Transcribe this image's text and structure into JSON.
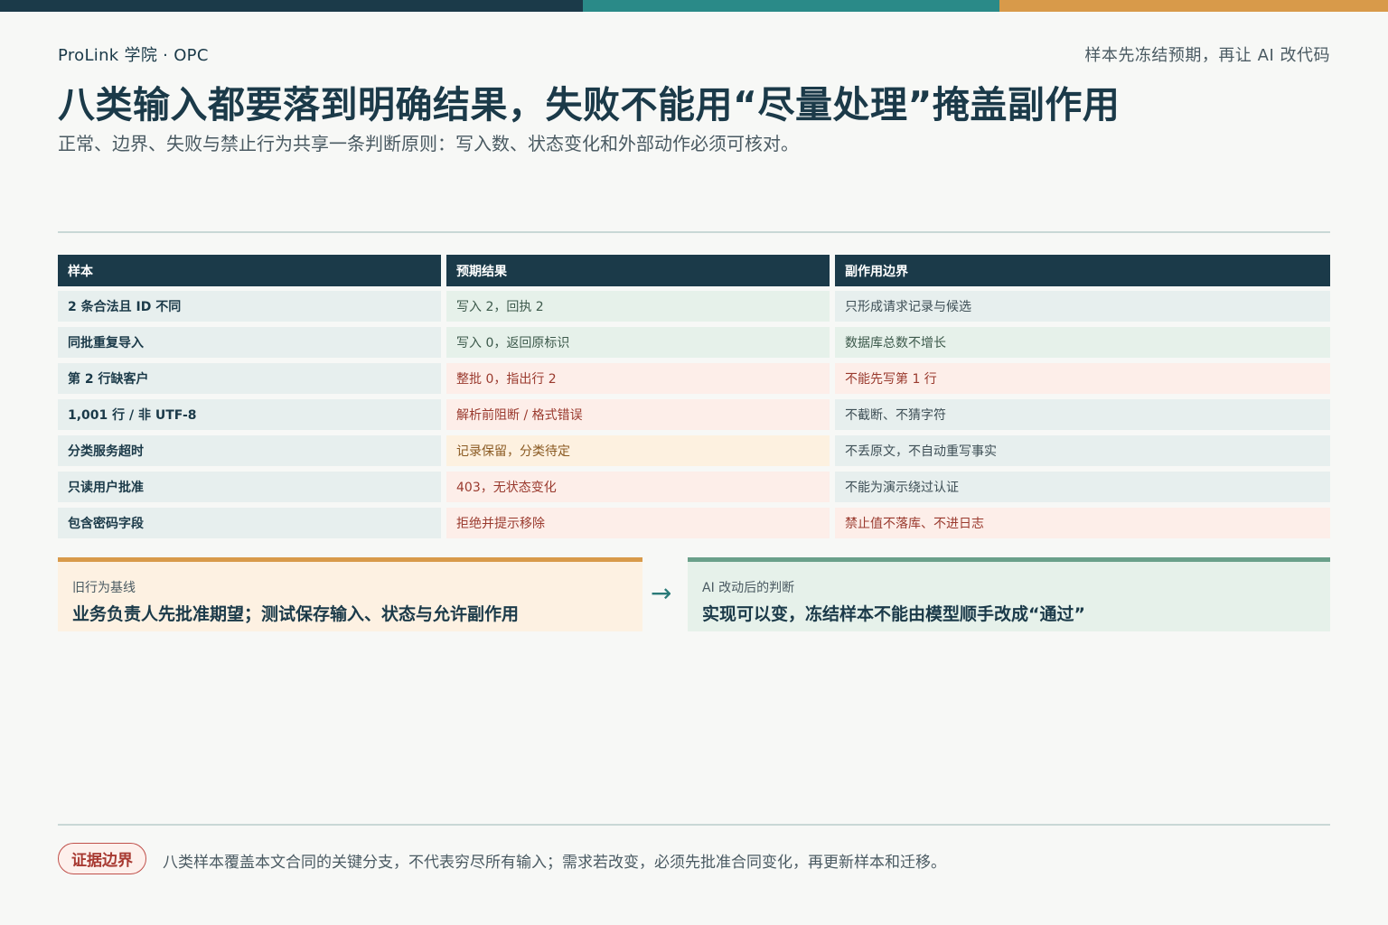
{
  "header": {
    "brand": "ProLink 学院 · OPC",
    "tagline": "样本先冻结预期，再让 AI 改代码",
    "title": "八类输入都要落到明确结果，失败不能用“尽量处理”掩盖副作用",
    "subtitle": "正常、边界、失败与禁止行为共享一条判断原则：写入数、状态变化和外部动作必须可核对。"
  },
  "table": {
    "columns": [
      "样本",
      "预期结果",
      "副作用边界"
    ],
    "rows": [
      {
        "sample": "2 条合法且 ID 不同",
        "expected": "写入 2，回执 2",
        "boundary": "只形成请求记录与候选",
        "expected_tone": "green",
        "boundary_tone": "neutral"
      },
      {
        "sample": "同批重复导入",
        "expected": "写入 0，返回原标识",
        "boundary": "数据库总数不增长",
        "expected_tone": "green",
        "boundary_tone": "green"
      },
      {
        "sample": "第 2 行缺客户",
        "expected": "整批 0，指出行 2",
        "boundary": "不能先写第 1 行",
        "expected_tone": "red",
        "boundary_tone": "red"
      },
      {
        "sample": "1,001 行 / 非 UTF-8",
        "expected": "解析前阻断 / 格式错误",
        "boundary": "不截断、不猜字符",
        "expected_tone": "red",
        "boundary_tone": "neutral"
      },
      {
        "sample": "分类服务超时",
        "expected": "记录保留，分类待定",
        "boundary": "不丢原文，不自动重写事实",
        "expected_tone": "amber",
        "boundary_tone": "neutral"
      },
      {
        "sample": "只读用户批准",
        "expected": "403，无状态变化",
        "boundary": "不能为演示绕过认证",
        "expected_tone": "red",
        "boundary_tone": "neutral"
      },
      {
        "sample": "包含密码字段",
        "expected": "拒绝并提示移除",
        "boundary": "禁止值不落库、不进日志",
        "expected_tone": "red",
        "boundary_tone": "red"
      }
    ]
  },
  "compare": {
    "old_label": "旧行为基线",
    "old_text": "业务负责人先批准期望；测试保存输入、状态与允许副作用",
    "arrow": "→",
    "new_label": "AI 改动后的判断",
    "new_text": "实现可以变，冻结样本不能由模型顺手改成“通过”"
  },
  "footer": {
    "badge": "证据边界",
    "note": "八类样本覆盖本文合同的关键分支，不代表穷尽所有输入；需求若改变，必须先批准合同变化，再更新样本和迁移。"
  },
  "colors": {
    "navy": "#1b3a49",
    "teal": "#2a8a88",
    "amber": "#d89a4a",
    "green_tint": "#e6f1ea",
    "red_tint": "#fdeee9",
    "amber_tint": "#fdf1e0"
  }
}
